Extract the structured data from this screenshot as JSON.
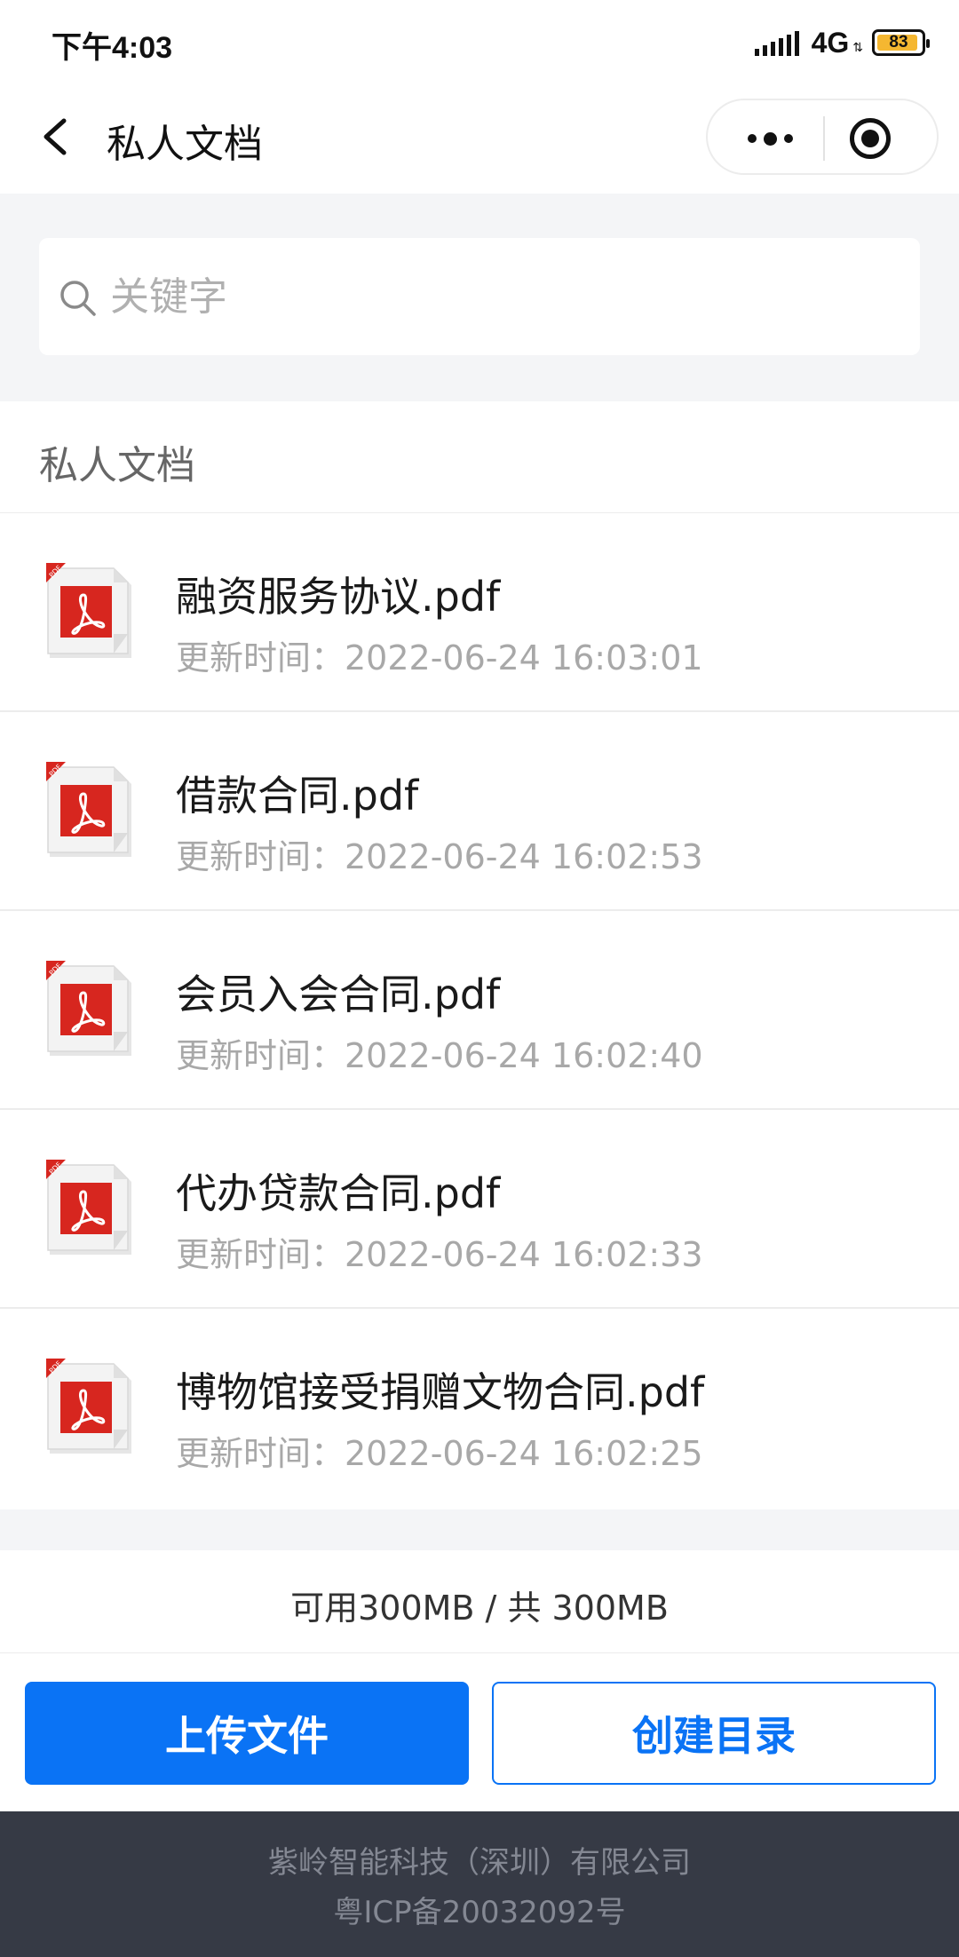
{
  "status_bar": {
    "time": "下午4:03",
    "network": "4G",
    "battery": "83"
  },
  "nav": {
    "title": "私人文档"
  },
  "search": {
    "placeholder": "关键字",
    "value": ""
  },
  "section": {
    "title": "私人文档"
  },
  "files": [
    {
      "name": "融资服务协议.pdf",
      "updated": "更新时间：2022-06-24 16:03:01"
    },
    {
      "name": "借款合同.pdf",
      "updated": "更新时间：2022-06-24 16:02:53"
    },
    {
      "name": "会员入会合同.pdf",
      "updated": "更新时间：2022-06-24 16:02:40"
    },
    {
      "name": "代办贷款合同.pdf",
      "updated": "更新时间：2022-06-24 16:02:33"
    },
    {
      "name": "博物馆接受捐赠文物合同.pdf",
      "updated": "更新时间：2022-06-24 16:02:25"
    }
  ],
  "storage": {
    "text": "可用300MB / 共 300MB"
  },
  "actions": {
    "upload_label": "上传文件",
    "create_dir_label": "创建目录"
  },
  "footer": {
    "company": "紫岭智能科技（深圳）有限公司",
    "icp": "粤ICP备20032092号"
  },
  "colors": {
    "accent": "#0a73f5",
    "footer_bg": "#363a45",
    "pdf_red": "#d7261f"
  },
  "icons": {
    "file": "pdf-file-icon",
    "search": "search-icon",
    "back": "chevron-left-icon",
    "more": "more-dots-icon",
    "close": "record-circle-icon"
  }
}
